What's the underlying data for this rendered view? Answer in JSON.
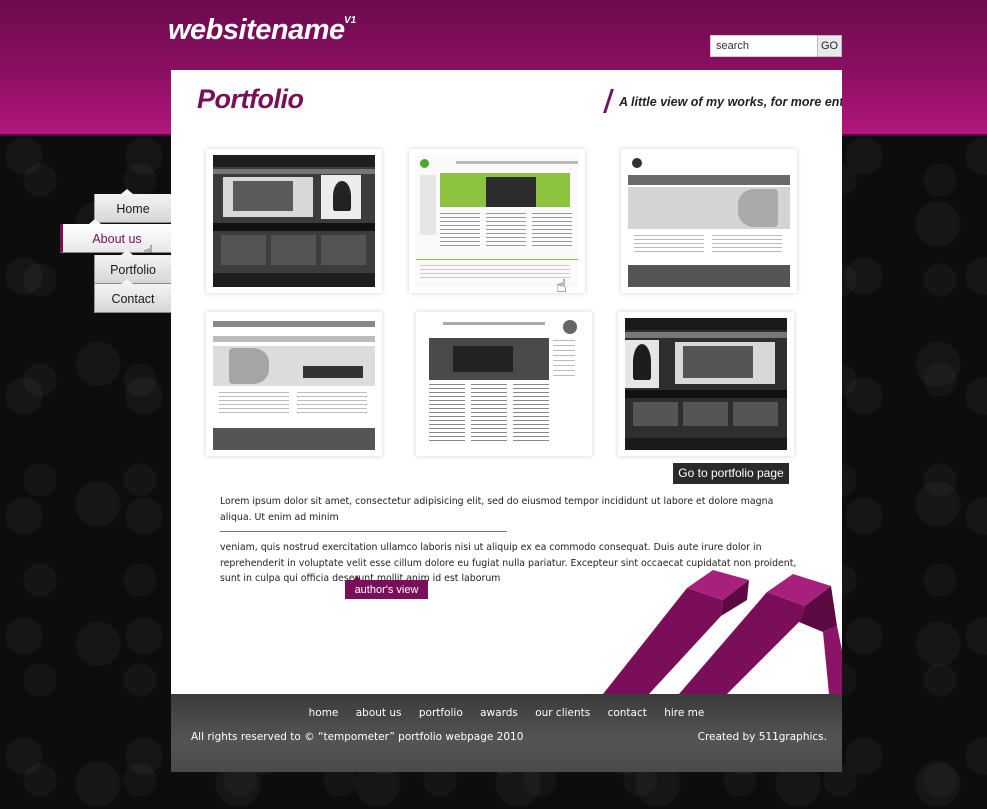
{
  "header": {
    "logo": "websitename",
    "logo_version": "V1",
    "search_placeholder": "search",
    "search_button": "GO"
  },
  "nav": [
    {
      "label": "Home"
    },
    {
      "label": "About us"
    },
    {
      "label": "Portfolio"
    },
    {
      "label": "Contact"
    }
  ],
  "page": {
    "title": "Portfolio",
    "tagline": "A little view of my works, for more enter...",
    "portfolio_button": "Go to portfolio page",
    "paragraph_1": "Lorem ipsum dolor sit amet, consectetur adipisicing elit, sed do eiusmod tempor incididunt ut labore et dolore magna aliqua. Ut enim ad minim",
    "paragraph_2": "veniam, quis nostrud exercitation ullamco laboris nisi ut aliquip ex ea commodo consequat. Duis aute irure dolor in reprehenderit in voluptate velit esse cillum dolore eu fugiat nulla pariatur. Excepteur sint occaecat cupidatat non proident, sunt in culpa qui officia deserunt mollit anim id est laborum",
    "author_button": "author's view"
  },
  "footer": {
    "links": [
      "home",
      "about us",
      "portfolio",
      "awards",
      "our clients",
      "contact",
      "hire me"
    ],
    "copyright": "All rights reserved to  ©  “tempometer” portfolio webpage 2010",
    "credit": "Created by 511graphics."
  },
  "colors": {
    "brand": "#7a0e58",
    "header_top": "#6a0b4c",
    "header_bottom": "#b2167c",
    "footer": "#4a4a4a",
    "background": "#0d0d0d"
  },
  "icons": {
    "cursor": "hand-cursor-icon"
  }
}
